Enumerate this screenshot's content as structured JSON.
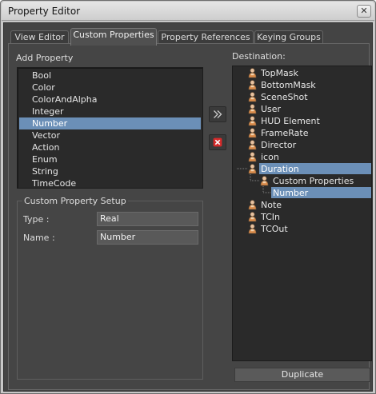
{
  "window": {
    "title": "Property Editor",
    "close_glyph": "✕"
  },
  "tabs": [
    {
      "label": "View Editor",
      "active": false
    },
    {
      "label": "Custom Properties",
      "active": true
    },
    {
      "label": "Property References",
      "active": false
    },
    {
      "label": "Keying Groups",
      "active": false
    }
  ],
  "add_property": {
    "label": "Add Property",
    "items": [
      "Bool",
      "Color",
      "ColorAndAlpha",
      "Integer",
      "Number",
      "Vector",
      "Action",
      "Enum",
      "String",
      "TimeCode"
    ],
    "selected": "Number"
  },
  "buttons": {
    "add_icon": "double-chevron-right-icon",
    "remove_icon": "red-x-icon"
  },
  "setup": {
    "title": "Custom Property Setup",
    "type_label": "Type :",
    "type_value": "Real",
    "name_label": "Name :",
    "name_value": "Number"
  },
  "destination": {
    "label": "Destination:",
    "nodes": [
      {
        "label": "TopMask",
        "depth": 0
      },
      {
        "label": "BottomMask",
        "depth": 0
      },
      {
        "label": "SceneShot",
        "depth": 0
      },
      {
        "label": "User",
        "depth": 0
      },
      {
        "label": "HUD Element",
        "depth": 0
      },
      {
        "label": "FrameRate",
        "depth": 0
      },
      {
        "label": "Director",
        "depth": 0
      },
      {
        "label": "icon",
        "depth": 0
      },
      {
        "label": "Duration",
        "depth": 0,
        "selected": true
      },
      {
        "label": "Custom Properties",
        "depth": 1
      },
      {
        "label": "Number",
        "depth": 2,
        "selected": true
      },
      {
        "label": "Note",
        "depth": 0
      },
      {
        "label": "TCIn",
        "depth": 0
      },
      {
        "label": "TCOut",
        "depth": 0
      }
    ],
    "node_icon": "actor-icon"
  },
  "duplicate_label": "Duplicate",
  "colors": {
    "selection": "#6b8fb7",
    "remove_red": "#d42a2a",
    "background": "#444444"
  }
}
